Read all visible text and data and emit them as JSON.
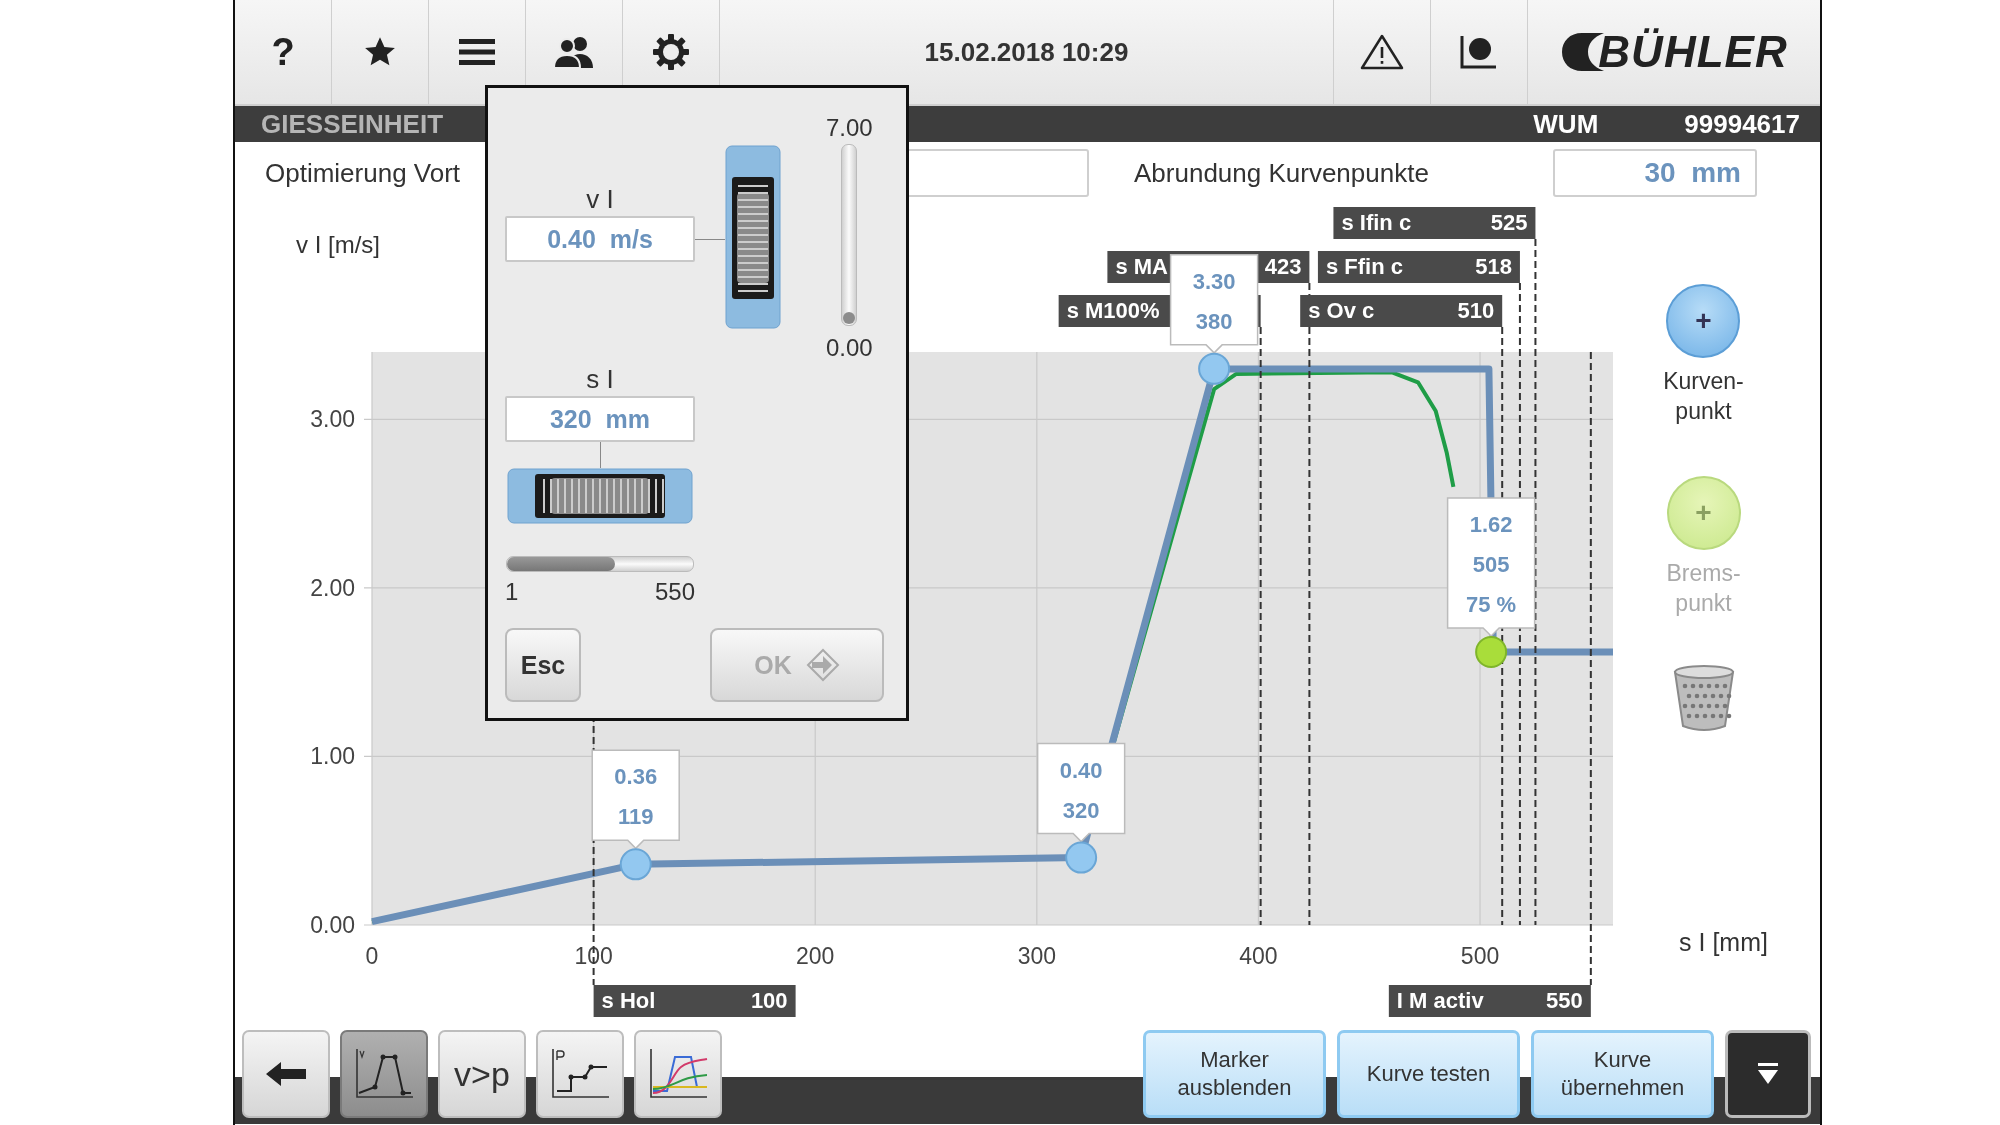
{
  "top_bar": {
    "left_buttons": [
      {
        "kind": "help",
        "label": "?"
      },
      {
        "kind": "favorites"
      },
      {
        "kind": "menu"
      },
      {
        "kind": "users"
      },
      {
        "kind": "settings"
      }
    ],
    "datetime": "15.02.2018 10:29",
    "right_buttons": [
      {
        "kind": "warning"
      },
      {
        "kind": "recorder"
      }
    ],
    "logo": "BÜHLER"
  },
  "header": {
    "title": "GIESSEINHEIT",
    "machine_label": "WUM",
    "machine_number": "99994617"
  },
  "settings": [
    {
      "label": "Optimierung Vort"
    },
    {
      "label": "Abrundung Kurvenpunkte",
      "value": "30  mm"
    }
  ],
  "chart": {
    "chart_data": {
      "type": "line",
      "xlabel": "s I [mm]",
      "ylabel": "v I [m/s]",
      "x": [
        0,
        119,
        320,
        380,
        390,
        460,
        472,
        480,
        485,
        488,
        504,
        506,
        560
      ],
      "series": [
        {
          "color": "#1f9d47",
          "values": [
            0.02,
            0.36,
            0.4,
            3.18,
            3.27,
            3.28,
            3.22,
            3.05,
            2.8,
            2.6,
            null,
            null,
            null
          ]
        },
        {
          "color": "#6b8fb8",
          "values": [
            0.02,
            0.36,
            0.4,
            3.3,
            3.3,
            3.3,
            3.3,
            3.3,
            3.3,
            3.3,
            3.3,
            1.62,
            1.62
          ]
        }
      ],
      "grid": true,
      "xlim": [
        0,
        560
      ],
      "ylim": [
        0,
        3.4
      ],
      "xticks": [
        0,
        100,
        200,
        300,
        400,
        500
      ],
      "yticks": [
        {
          "value": 0,
          "label": "0.00"
        },
        {
          "value": 1,
          "label": "1.00"
        },
        {
          "value": 2,
          "label": "2.00"
        },
        {
          "value": 3,
          "label": "3.00"
        }
      ]
    },
    "markers": [
      {
        "label": "s Ifin c",
        "value": "525"
      },
      {
        "label": "s MA",
        "value": "423"
      },
      {
        "label": "s Ffin c",
        "value": "518"
      },
      {
        "label": "s M100%"
      },
      {
        "label": "s Ov c",
        "value": "510"
      },
      {
        "label": "s Hol",
        "value": "100"
      },
      {
        "label": "I M activ",
        "value": "550"
      }
    ],
    "points": [
      {
        "kind": "curve",
        "texts": [
          "0.36",
          "119"
        ]
      },
      {
        "kind": "curve",
        "texts": [
          "0.40",
          "320"
        ]
      },
      {
        "kind": "curve",
        "texts": [
          "3.30",
          "380"
        ]
      },
      {
        "kind": "brake",
        "texts": [
          "1.62",
          "505",
          "75 %"
        ]
      }
    ]
  },
  "side_buttons": [
    {
      "symbol": "+",
      "lines": [
        "Kurven-",
        "punkt"
      ],
      "disabled": false
    },
    {
      "symbol": "+",
      "lines": [
        "Brems-",
        "punkt"
      ],
      "disabled": true
    }
  ],
  "popup": {
    "speed": {
      "label": "v I",
      "value": "0.40  m/s",
      "max": "7.00",
      "min": "0.00",
      "level": 0.057
    },
    "position": {
      "label": "s I",
      "value": "320  mm",
      "min": "1",
      "max": "550",
      "level": 0.58
    },
    "buttons": [
      {
        "label": "Esc",
        "disabled": false
      },
      {
        "label": "OK",
        "disabled": true
      }
    ]
  },
  "bottom_tools": [
    {
      "kind": "back",
      "selected": false
    },
    {
      "kind": "velocity-profile",
      "selected": true
    },
    {
      "kind": "text",
      "label": "v>p",
      "selected": false
    },
    {
      "kind": "pressure-profile",
      "selected": false
    },
    {
      "kind": "multi-curve",
      "selected": false
    }
  ],
  "actions": [
    {
      "lines": [
        "Marker",
        "ausblenden"
      ]
    },
    {
      "lines": [
        "Kurve testen"
      ]
    },
    {
      "lines": [
        "Kurve",
        "übernehmen"
      ]
    }
  ]
}
